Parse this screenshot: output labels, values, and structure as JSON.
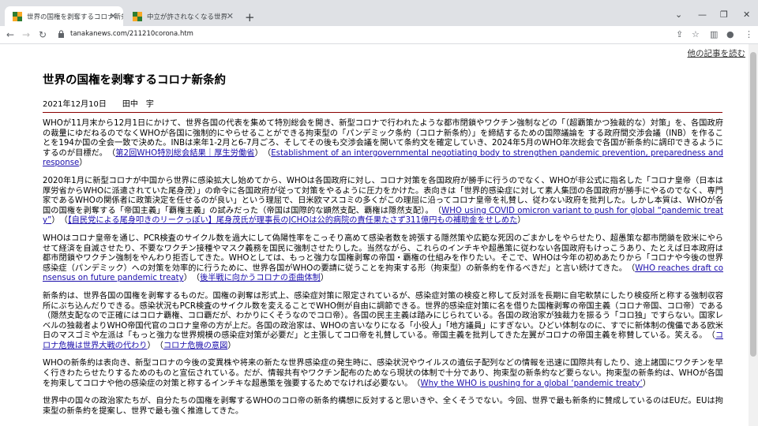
{
  "tabs": [
    {
      "title": "世界の国権を剥奪するコロナ新条約",
      "active": true
    },
    {
      "title": "中立が許されなくなる世界",
      "active": false
    }
  ],
  "address_bar": {
    "url": "tanakanews.com/211210corona.htm"
  },
  "article": {
    "other_articles_link": "他の記事を読む",
    "title": "世界の国権を剥奪するコロナ新条約",
    "date_author": "2021年12月10日　　田中　宇",
    "paragraphs": [
      [
        {
          "t": "WHOが11月末から12月1日にかけて、世界各国の代表を集めて特別総会を開き、新型コロナで行われたような都市閉鎖やワクチン強制などの「（超覇策かつ独裁的な）対策」を、各国政府の裁量にゆだねるのでなくWHOが各国に強制的にやらせることができる拘束型の「パンデミック条約（コロナ新条約）」を締結するための国際議論を する政府間交渉会議（INB）を作ることを194か国の全会一致で決めた。INBは来年1-2月と6-7月ごろ、そしてその後も交渉会議を開いて条約文を確定していき、2024年5月のWHO年次総会で各国が新条約に調印できるようにするのが目標だ。　（"
        },
        {
          "t": "第2回WHO特別総会結果｜厚生労働省",
          "link": true
        },
        {
          "t": "）　（"
        },
        {
          "t": "Establishment of an intergovernmental negotiating body to strengthen pandemic prevention, preparedness and response",
          "link": true
        },
        {
          "t": "）"
        }
      ],
      [
        {
          "t": "2020年1月に新型コロナが中国から世界に感染拡大し始めてから、WHOは各国政府に対し、コロナ対策を各国政府が勝手に行うのでなく、WHOが非公式に指名した「コロナ皇帝（日本は厚労省からWHOに派遣されていた尾身茂）」の命令に各国政府が従って対策をやるように圧力をかけた。表向きは「世界的感染症に対して素人集団の各国政府が勝手にやるのでなく、専門家であるWHOの関係者に政策決定を任せるのが良い」という理屈で、日米欧マスコミの多くがこの理屈に沿ってコロナ皇帝を礼賛し、従わない政府を批判した。しかし本質は、WHOが各国の国権を剥奪する「帝国主義」「覇権主義」の試みだった（帝国は国際的な顕然支配、覇権は隠然支配）。　（"
        },
        {
          "t": "WHO using COVID omicron variant to push for global “pandemic treaty”",
          "link": true
        },
        {
          "t": "）　（"
        },
        {
          "t": "【自民党による尾身叩きのリークっぽい】尾身茂氏が理事長のJCHOは公的病院の責任果たさず311億円もの補助金をせしめた",
          "link": true
        },
        {
          "t": "）"
        }
      ],
      [
        {
          "t": "WHOはコロナ皇帝を通じ、PCR検査のサイクル数を過大にして偽陽性率をこっそり高めて感染者数を誇張する隠然策や広範な死因のごまかしをやらせたり、超愚策な都市閉鎖を欧米にやらせて経済を自滅させたり、不要なワクチン接種やマスク義務を国民に強制させたりした。当然ながら、これらのインチキや超愚策に従わない各国政府もけっこうあり、たとえば日本政府は都市閉鎖やワクチン強制をやんわり拒否してきた。WHOとしては、もっと強力な国権剥奪の帝国・覇権の仕組みを作りたい。そこで、WHOは今年の初めあたりから「コロナや今後の世界感染症（パンデミック）への対策を効率的に行うために、世界各国がWHOの要請に従うことを拘束する形（拘束型）の新条約を作るべきだ」と言い続けてきた。　（"
        },
        {
          "t": "WHO reaches draft consensus on future pandemic treaty",
          "link": true
        },
        {
          "t": "）　（"
        },
        {
          "t": "後半戦に向かうコロナの歪曲体制",
          "link": true
        },
        {
          "t": "）"
        }
      ],
      [
        {
          "t": "新条約は、世界各国の国権を剥奪するものだ。国権の剥奪は形式上、感染症対策に限定されているが、感染症対策の検疫と称して反対派を長期に自宅軟禁にしたり検疫所と称する強制収容所にぶち込んだりできる。感染状況もPCR検査のサイクル数を変えることでWHO側が自由に調節できる。世界的感染症対策に名を借りた国権剥奪の帝国主義（コロナ帝国、コロ帝）である（隠然支配なので正確にはコロナ覇権、コロ覇だが、わかりにくそうなのでコロ帝）。各国の民主主義は踏みにじられている。各国の政治家が独裁力を振るう「コロ独」ですらない。国家レベルの独裁者よりWHO帝国代官のコロナ皇帝の方が上だ。各国の政治家は、WHOの言いなりになる「小役人」「地方議員」にすぎない。ひどい体制なのに、すでに新体制の傀儡である欧米日のマスゴミや左派は「もっと強力な世界規模の感染症対策が必要だ」と主張してコロ帝を礼賛している。帝国主義を批判してきた左翼がコロナの帝国主義を称賛している。笑える。　（"
        },
        {
          "t": "コロナ危機は世界大戦の代わり",
          "link": true
        },
        {
          "t": "）　（"
        },
        {
          "t": "コロナ危機の意図",
          "link": true
        },
        {
          "t": "）"
        }
      ],
      [
        {
          "t": "WHOの新条約は表向き、新型コロナの今後の変異株や将来の新たな世界感染症の発生時に、感染状況やウイルスの遺伝子配列などの情報を迅速に国際共有したり、途上諸国にワクチンを早く行きわたらせたりするためのものと宣伝されている。だが、情報共有やワクチン配布のためなら現状の体制で十分であり、拘束型の新条約など要らない。拘束型の新条約は、WHOが各国を拘束してコロナや他の感染症の対策と称するインチキな超愚策を強要するためでなければ必要ない。　（"
        },
        {
          "t": "Why the WHO is pushing for a global ‘pandemic treaty’",
          "link": true
        },
        {
          "t": "）"
        }
      ],
      [
        {
          "t": "世界中の国々の政治家たちが、自分たちの国権を剥奪するWHOのコロ帝の新条約構想に反対すると思いきや、全くそうでない。今回、世界で最も新条約に賛成しているのはEUだ。EUは拘束型の新条約を提案し、世界で最も強く推進してきた。"
        }
      ]
    ]
  }
}
